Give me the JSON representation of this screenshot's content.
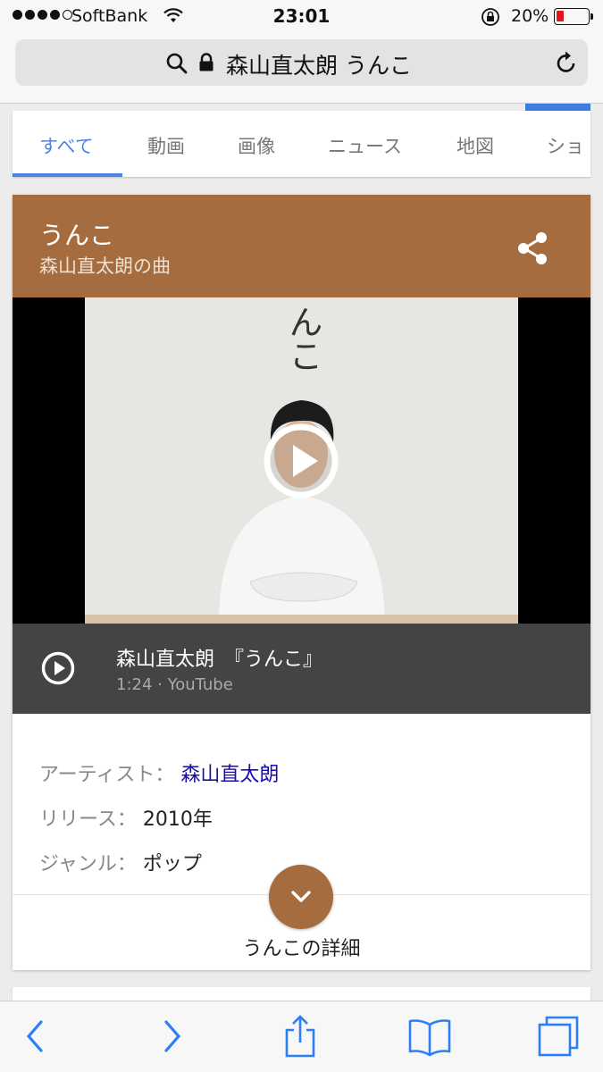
{
  "status_bar": {
    "carrier": "SoftBank",
    "time": "23:01",
    "battery_percent": "20%",
    "battery_color": "#e0181e"
  },
  "url_bar": {
    "query": "森山直太朗 うんこ",
    "icons": [
      "search-icon",
      "lock-icon",
      "reload-icon"
    ]
  },
  "tabs": [
    {
      "label": "すべて",
      "active": true
    },
    {
      "label": "動画"
    },
    {
      "label": "画像"
    },
    {
      "label": "ニュース"
    },
    {
      "label": "地図"
    },
    {
      "label": "ショ"
    }
  ],
  "card": {
    "title": "うんこ",
    "subtitle": "森山直太朗の曲",
    "accent_color": "#a56d3f",
    "thumbnail_text": "んこ",
    "video": {
      "title": "森山直太朗　『うんこ』",
      "meta": "1:24 · YouTube"
    },
    "facts": [
      {
        "key": "アーティスト：",
        "value": "森山直太朗",
        "is_link": true
      },
      {
        "key": "リリース：",
        "value": "2010年"
      },
      {
        "key": "ジャンル：",
        "value": "ポップ"
      }
    ],
    "more_label": "うんこの詳細"
  },
  "toolbar": {
    "icons": [
      "back-icon",
      "forward-icon",
      "share-icon",
      "bookmarks-icon",
      "tabs-icon"
    ]
  }
}
